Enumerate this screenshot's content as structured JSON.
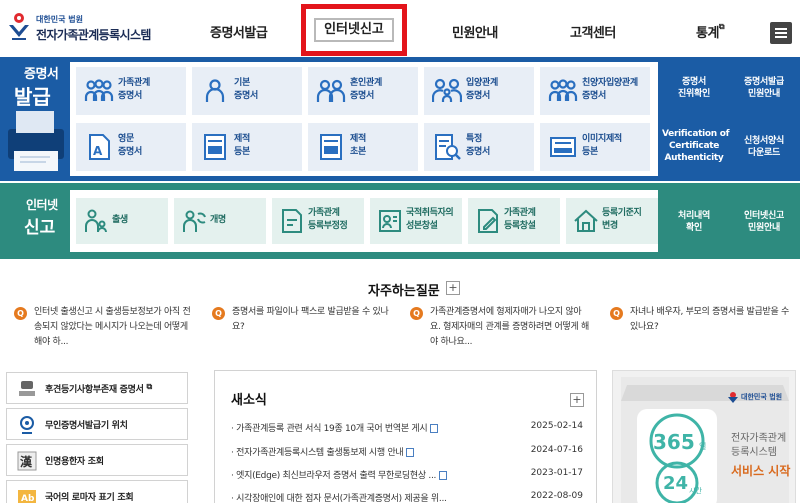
{
  "header": {
    "logo_small": "대한민국 법원",
    "logo_main": "전자가족관계등록시스템",
    "nav": [
      {
        "label": "증명서발급"
      },
      {
        "label": "인터넷신고"
      },
      {
        "label": "민원안내"
      },
      {
        "label": "고객센터"
      },
      {
        "label": "통계"
      }
    ]
  },
  "issue": {
    "title_line1": "증명서",
    "title_line2": "발급",
    "tiles": [
      {
        "label": "가족관계\n증명서",
        "icon": "family-icon"
      },
      {
        "label": "기본\n증명서",
        "icon": "person-icon"
      },
      {
        "label": "혼인관계\n증명서",
        "icon": "couple-icon"
      },
      {
        "label": "입양관계\n증명서",
        "icon": "adoption-icon"
      },
      {
        "label": "친양자입양관계\n증명서",
        "icon": "family-icon"
      },
      {
        "label": "영문\n증명서",
        "icon": "english-doc-icon"
      },
      {
        "label": "제적\n등본",
        "icon": "removed-record-icon"
      },
      {
        "label": "제적\n초본",
        "icon": "removed-record-icon"
      },
      {
        "label": "특정\n증명서",
        "icon": "search-doc-icon"
      },
      {
        "label": "이미지제적\n등본",
        "icon": "image-record-icon"
      }
    ],
    "side_links": [
      {
        "label": "증명서\n진위확인"
      },
      {
        "label": "증명서발급\n민원안내"
      },
      {
        "label": "Verification of\nCertificate\nAuthenticity"
      },
      {
        "label": "신청서양식\n다운로드"
      }
    ]
  },
  "report": {
    "title_line1": "인터넷",
    "title_line2": "신고",
    "tiles": [
      {
        "label": "출생",
        "icon": "birth-icon"
      },
      {
        "label": "개명",
        "icon": "rename-icon"
      },
      {
        "label": "가족관계\n등록부정정",
        "icon": "correction-icon"
      },
      {
        "label": "국적취득자의\n성본창설",
        "icon": "nationality-icon"
      },
      {
        "label": "가족관계\n등록창설",
        "icon": "create-record-icon"
      },
      {
        "label": "등록기준지\n변경",
        "icon": "home-icon"
      }
    ],
    "side_links": [
      {
        "label": "처리내역\n확인"
      },
      {
        "label": "인터넷신고\n민원안내"
      }
    ]
  },
  "faq": {
    "title": "자주하는질문",
    "items": [
      "인터넷 출생신고 시 출생등보정보가 아직 전송되지 않았다는 메시지가 나오는데 어떻게 해야 하...",
      "증명서를 파일이나 팩스로 발급받을 수 있나요?",
      "가족관계증명서에 형제자매가 나오지 않아요. 형제자매의 관계를 증명하려면 어떻게 해야 하나요...",
      "자녀나 배우자, 부모의 증명서를 발급받을 수 있나요?"
    ]
  },
  "quick_links": [
    {
      "label": "후견등기사항부존재 증명서",
      "icon": "seal-icon"
    },
    {
      "label": "무인증명서발급기 위치",
      "icon": "location-icon"
    },
    {
      "label": "인명용한자 조회",
      "icon": "hanja-icon"
    },
    {
      "label": "국어의 로마자 표기 조회",
      "icon": "roman-icon"
    }
  ],
  "news": {
    "title": "새소식",
    "items": [
      {
        "title": "가족관계등록 관련 서식 19종 10개 국어 번역본 게시",
        "date": "2025-02-14"
      },
      {
        "title": "전자가족관계등록시스템 출생통보제 시행 안내",
        "date": "2024-07-16"
      },
      {
        "title": "엣지(Edge) 최신브라우저 증명서 출력 무한로딩현상 ...",
        "date": "2023-01-17"
      },
      {
        "title": "시각장애인에 대한 점자 문서(가족관계증명서) 제공을 위...",
        "date": "2022-08-09"
      }
    ]
  },
  "banner": {
    "logo": "대한민국 법원",
    "big1": "365",
    "big1_unit": "일",
    "big2": "24",
    "big2_unit": "시간",
    "line1": "전자가족관계",
    "line2": "등록시스템",
    "line3": "서비스 시작"
  },
  "colors": {
    "issue_band": "#1b5ca5",
    "report_band": "#2d8b7f",
    "highlight": "#e3141b",
    "faq_badge": "#e57a1f"
  }
}
